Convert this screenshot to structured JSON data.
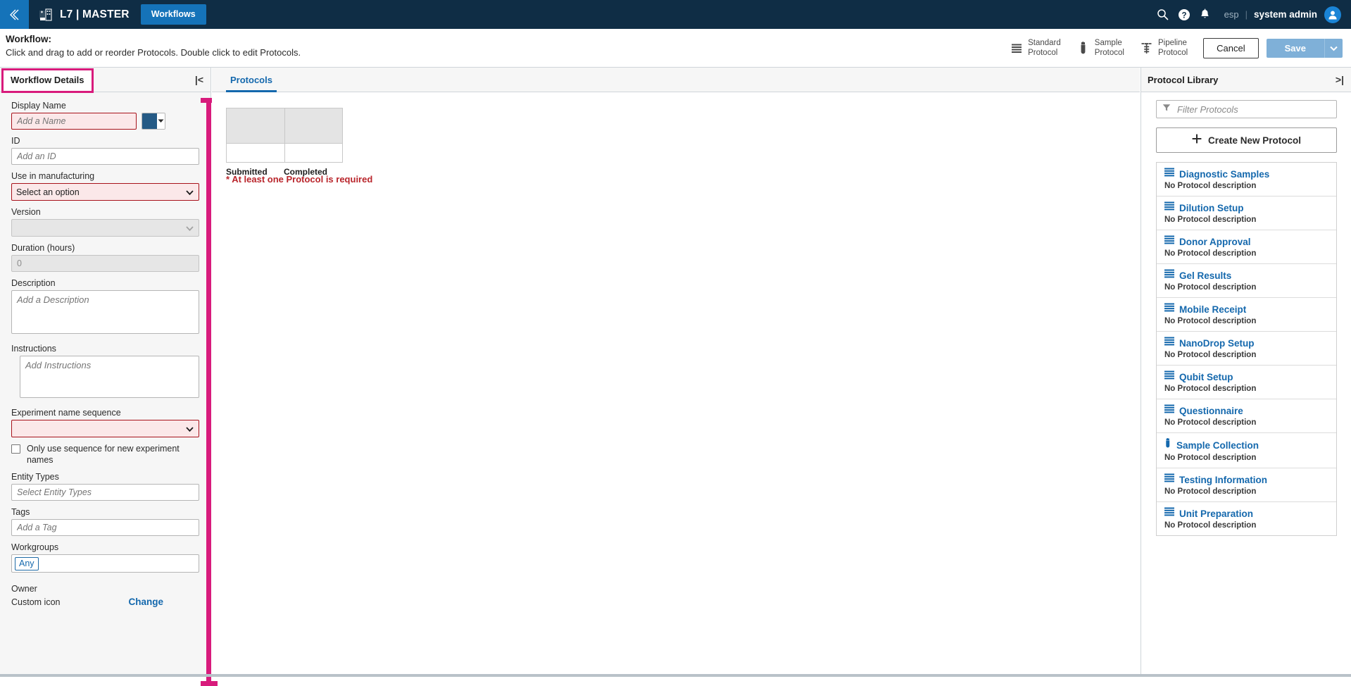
{
  "topbar": {
    "back_icon": "chevron-left-double-icon",
    "logo_icon": "app-grid-icon",
    "app_title": "L7 | MASTER",
    "nav_tab": "Workflows",
    "search_icon": "search-icon",
    "help_icon": "help-circle-icon",
    "notifications_icon": "bell-icon",
    "language": "esp",
    "separator": "|",
    "user_name": "system admin",
    "avatar_icon": "user-avatar-icon"
  },
  "pagehead": {
    "title": "Workflow:",
    "subtitle": "Click and drag to add or reorder Protocols. Double click to edit Protocols.",
    "actions": [
      {
        "label_line1": "Standard",
        "label_line2": "Protocol",
        "icon": "standard-protocol-icon"
      },
      {
        "label_line1": "Sample",
        "label_line2": "Protocol",
        "icon": "sample-protocol-icon"
      },
      {
        "label_line1": "Pipeline",
        "label_line2": "Protocol",
        "icon": "pipeline-protocol-icon"
      }
    ],
    "cancel_label": "Cancel",
    "save_label": "Save",
    "save_caret_icon": "chevron-down-icon"
  },
  "left_panel": {
    "title": "Workflow Details",
    "collapse_icon": "collapse-left-icon",
    "fields": {
      "display_name_label": "Display Name",
      "display_name_placeholder": "Add a Name",
      "color_swatch_hex": "#255a85",
      "id_label": "ID",
      "id_placeholder": "Add an ID",
      "use_in_manufacturing_label": "Use in manufacturing",
      "use_in_manufacturing_value": "Select an option",
      "version_label": "Version",
      "version_value": "",
      "duration_label": "Duration (hours)",
      "duration_value": "0",
      "description_label": "Description",
      "description_placeholder": "Add a Description",
      "instructions_label": "Instructions",
      "instructions_placeholder": "Add Instructions",
      "experiment_name_sequence_label": "Experiment name sequence",
      "experiment_name_sequence_value": "",
      "only_use_sequence_label": "Only use sequence for new experiment names",
      "entity_types_label": "Entity Types",
      "entity_types_placeholder": "Select Entity Types",
      "tags_label": "Tags",
      "tags_placeholder": "Add a Tag",
      "workgroups_label": "Workgroups",
      "workgroups_chip": "Any",
      "owner_label": "Owner",
      "custom_icon_label": "Custom icon",
      "change_link": "Change"
    }
  },
  "center_panel": {
    "tab_label": "Protocols",
    "flow_columns": [
      "Submitted",
      "Completed"
    ],
    "error_message": "* At least one Protocol is required"
  },
  "right_panel": {
    "title": "Protocol Library",
    "collapse_icon": "collapse-right-icon",
    "filter_placeholder": "Filter Protocols",
    "filter_icon": "funnel-icon",
    "create_button_label": "Create New Protocol",
    "create_button_icon": "plus-icon",
    "protocols": [
      {
        "name": "Diagnostic Samples",
        "description": "No Protocol description",
        "icon": "standard-protocol-icon"
      },
      {
        "name": "Dilution Setup",
        "description": "No Protocol description",
        "icon": "standard-protocol-icon"
      },
      {
        "name": "Donor Approval",
        "description": "No Protocol description",
        "icon": "standard-protocol-icon"
      },
      {
        "name": "Gel Results",
        "description": "No Protocol description",
        "icon": "standard-protocol-icon"
      },
      {
        "name": "Mobile Receipt",
        "description": "No Protocol description",
        "icon": "standard-protocol-icon"
      },
      {
        "name": "NanoDrop Setup",
        "description": "No Protocol description",
        "icon": "standard-protocol-icon"
      },
      {
        "name": "Qubit Setup",
        "description": "No Protocol description",
        "icon": "standard-protocol-icon"
      },
      {
        "name": "Questionnaire",
        "description": "No Protocol description",
        "icon": "standard-protocol-icon"
      },
      {
        "name": "Sample Collection",
        "description": "No Protocol description",
        "icon": "sample-protocol-icon"
      },
      {
        "name": "Testing Information",
        "description": "No Protocol description",
        "icon": "standard-protocol-icon"
      },
      {
        "name": "Unit Preparation",
        "description": "No Protocol description",
        "icon": "standard-protocol-icon"
      }
    ]
  },
  "colors": {
    "nav_bg": "#0f2d45",
    "accent_blue": "#1573b9",
    "link_blue": "#1468ad",
    "error_red": "#b9252b",
    "highlight_pink": "#d81b7c"
  }
}
